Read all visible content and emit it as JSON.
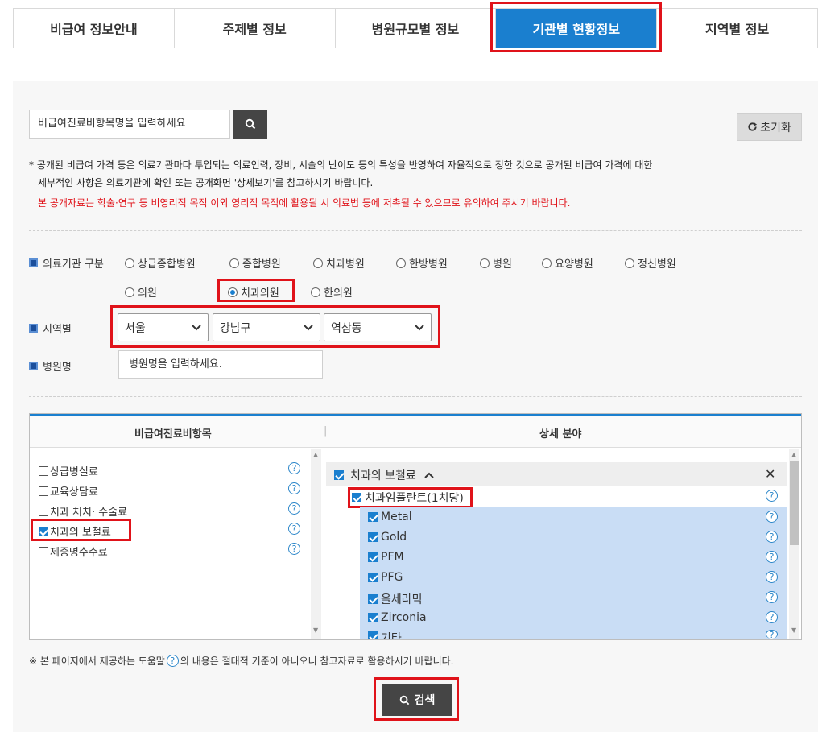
{
  "tabs": [
    {
      "label": "비급여 정보안내"
    },
    {
      "label": "주제별 정보"
    },
    {
      "label": "병원규모별 정보"
    },
    {
      "label": "기관별 현황정보"
    },
    {
      "label": "지역별 정보"
    }
  ],
  "search": {
    "placeholder": "비급여진료비항목명을 입력하세요",
    "reset_label": "초기화"
  },
  "notes": {
    "line1": "* 공개된 비급여 가격 등은 의료기관마다 투입되는 의료인력, 장비, 시술의 난이도 등의 특성을 반영하여 자율적으로 정한 것으로 공개된 비급여 가격에 대한",
    "line2": "세부적인 사항은 의료기관에 확인 또는 공개화면 '상세보기'를 참고하시기 바랍니다.",
    "warning": "본 공개자료는 학술·연구 등 비영리적 목적 이외 영리적 목적에 활용될 시 의료법 등에 저촉될 수 있으므로 유의하여 주시기 바랍니다."
  },
  "filters": {
    "institution_label": "의료기관 구분",
    "institution_types": [
      "상급종합병원",
      "종합병원",
      "치과병원",
      "한방병원",
      "병원",
      "요양병원",
      "정신병원",
      "의원",
      "치과의원",
      "한의원"
    ],
    "institution_selected": "치과의원",
    "region_label": "지역별",
    "region": {
      "sido": "서울",
      "sigungu": "강남구",
      "dong": "역삼동"
    },
    "hospital_label": "병원명",
    "hospital_placeholder": "병원명을 입력하세요."
  },
  "listbox": {
    "left_header": "비급여진료비항목",
    "right_header": "상세 분야",
    "left_items": [
      {
        "label": "상급병실료",
        "checked": false
      },
      {
        "label": "교육상담료",
        "checked": false
      },
      {
        "label": "치과 처치· 수술료",
        "checked": false
      },
      {
        "label": "치과의 보철료",
        "checked": true
      },
      {
        "label": "제증명수수료",
        "checked": false
      }
    ],
    "right_group": "치과의 보철료",
    "right_sub": "치과임플란트(1치당)",
    "right_items": [
      "Metal",
      "Gold",
      "PFM",
      "PFG",
      "올세라믹",
      "Zirconia",
      "기타"
    ]
  },
  "footer": {
    "note_before": "※ 본 페이지에서 제공하는 도움말",
    "note_after": "의 내용은 절대적 기준이 아니오니 참고자료로 활용하시기 바랍니다.",
    "search_button": "검색"
  }
}
